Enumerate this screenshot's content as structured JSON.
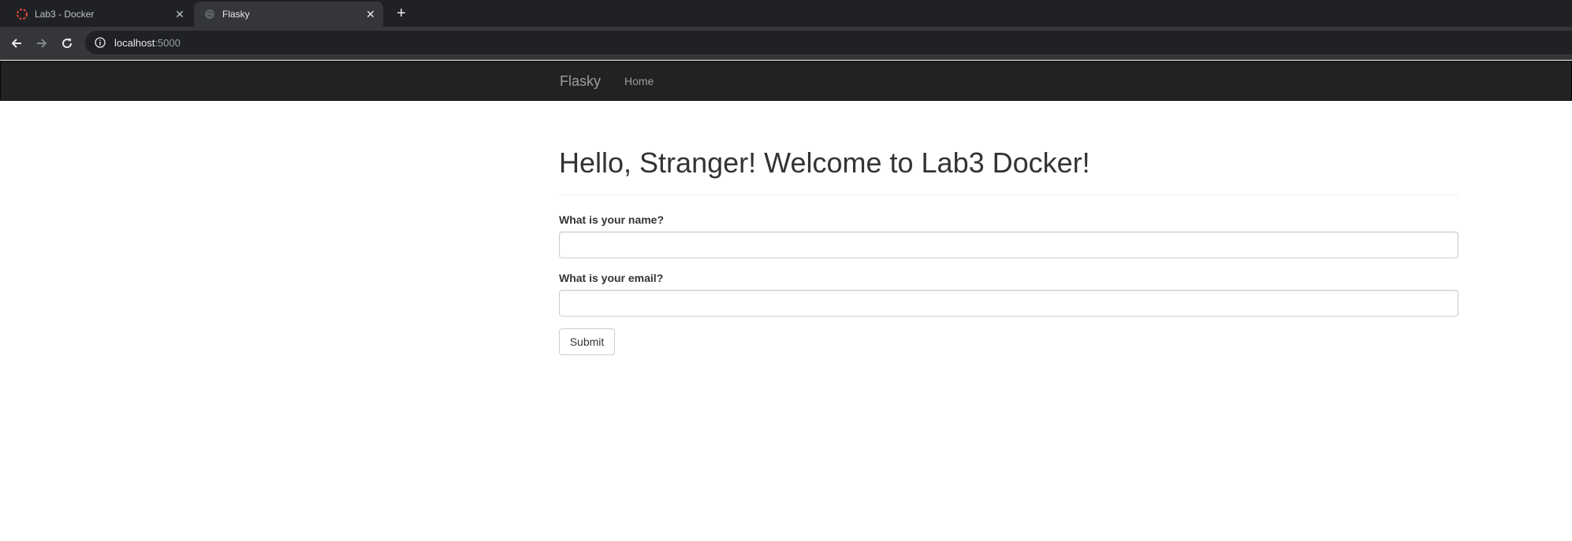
{
  "browser": {
    "tabs": [
      {
        "title": "Lab3 - Docker",
        "favicon": "docker-loading-icon",
        "active": false
      },
      {
        "title": "Flasky",
        "favicon": "globe-icon",
        "active": true
      }
    ],
    "new_tab_label": "+",
    "address": {
      "host": "localhost",
      "port": ":5000"
    }
  },
  "navbar": {
    "brand": "Flasky",
    "links": [
      {
        "label": "Home"
      }
    ]
  },
  "page": {
    "heading": "Hello, Stranger! Welcome to Lab3 Docker!",
    "form": {
      "name_label": "What is your name?",
      "name_value": "",
      "email_label": "What is your email?",
      "email_value": "",
      "submit_label": "Submit"
    }
  },
  "colors": {
    "tab_strip": "#202124",
    "toolbar": "#35363a",
    "navbar": "#222222",
    "navbar_text": "#9d9d9d",
    "heading_text": "#333333"
  }
}
